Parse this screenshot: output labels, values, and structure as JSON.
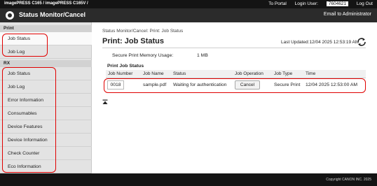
{
  "topbar": {
    "device_name": "imagePRESS C165 / imagePRESS C165V /",
    "to_portal": "To Portal",
    "login_user_label": "Login User:",
    "login_user_value": "7604621",
    "logout": "Log Out"
  },
  "header": {
    "app_title": "Status Monitor/Cancel",
    "email_admin": "Email to Administrator"
  },
  "sidebar": {
    "print_heading": "Print",
    "print_items": [
      "Job Status",
      "Job Log"
    ],
    "rx_heading": "RX",
    "rx_items": [
      "Job Status",
      "Job Log",
      "Error Information",
      "Consumables",
      "Device Features",
      "Device Information",
      "Check Counter",
      "Eco Information"
    ],
    "active_item": "Job Status"
  },
  "main": {
    "breadcrumb": "Status Monitor/Cancel: Print: Job Status",
    "title": "Print: Job Status",
    "last_updated": "Last Updated:12/04 2025 12:53:19 AM",
    "memory_label": "Secure Print Memory Usage:",
    "memory_value": "1 MB",
    "section_title": "Print Job Status",
    "table": {
      "headers": [
        "Job Number",
        "Job Name",
        "Status",
        "Job Operation",
        "Job Type",
        "Time"
      ],
      "rows": [
        {
          "job_number": "0018",
          "job_name": "sample.pdf",
          "status": "Waiting for authentication",
          "operation": "Cancel",
          "job_type": "Secure Print",
          "time": "12/04 2025 12:53:00 AM"
        }
      ]
    }
  },
  "footer": {
    "copyright": "Copyright CANON INC. 2025"
  },
  "colors": {
    "highlight": "#e00000",
    "header_bg": "#2b2b2b",
    "topbar_bg": "#141414",
    "sidebar_bg": "#e3e3e3"
  },
  "icons": [
    "canon-logo-icon",
    "refresh-icon",
    "page-top-icon"
  ]
}
